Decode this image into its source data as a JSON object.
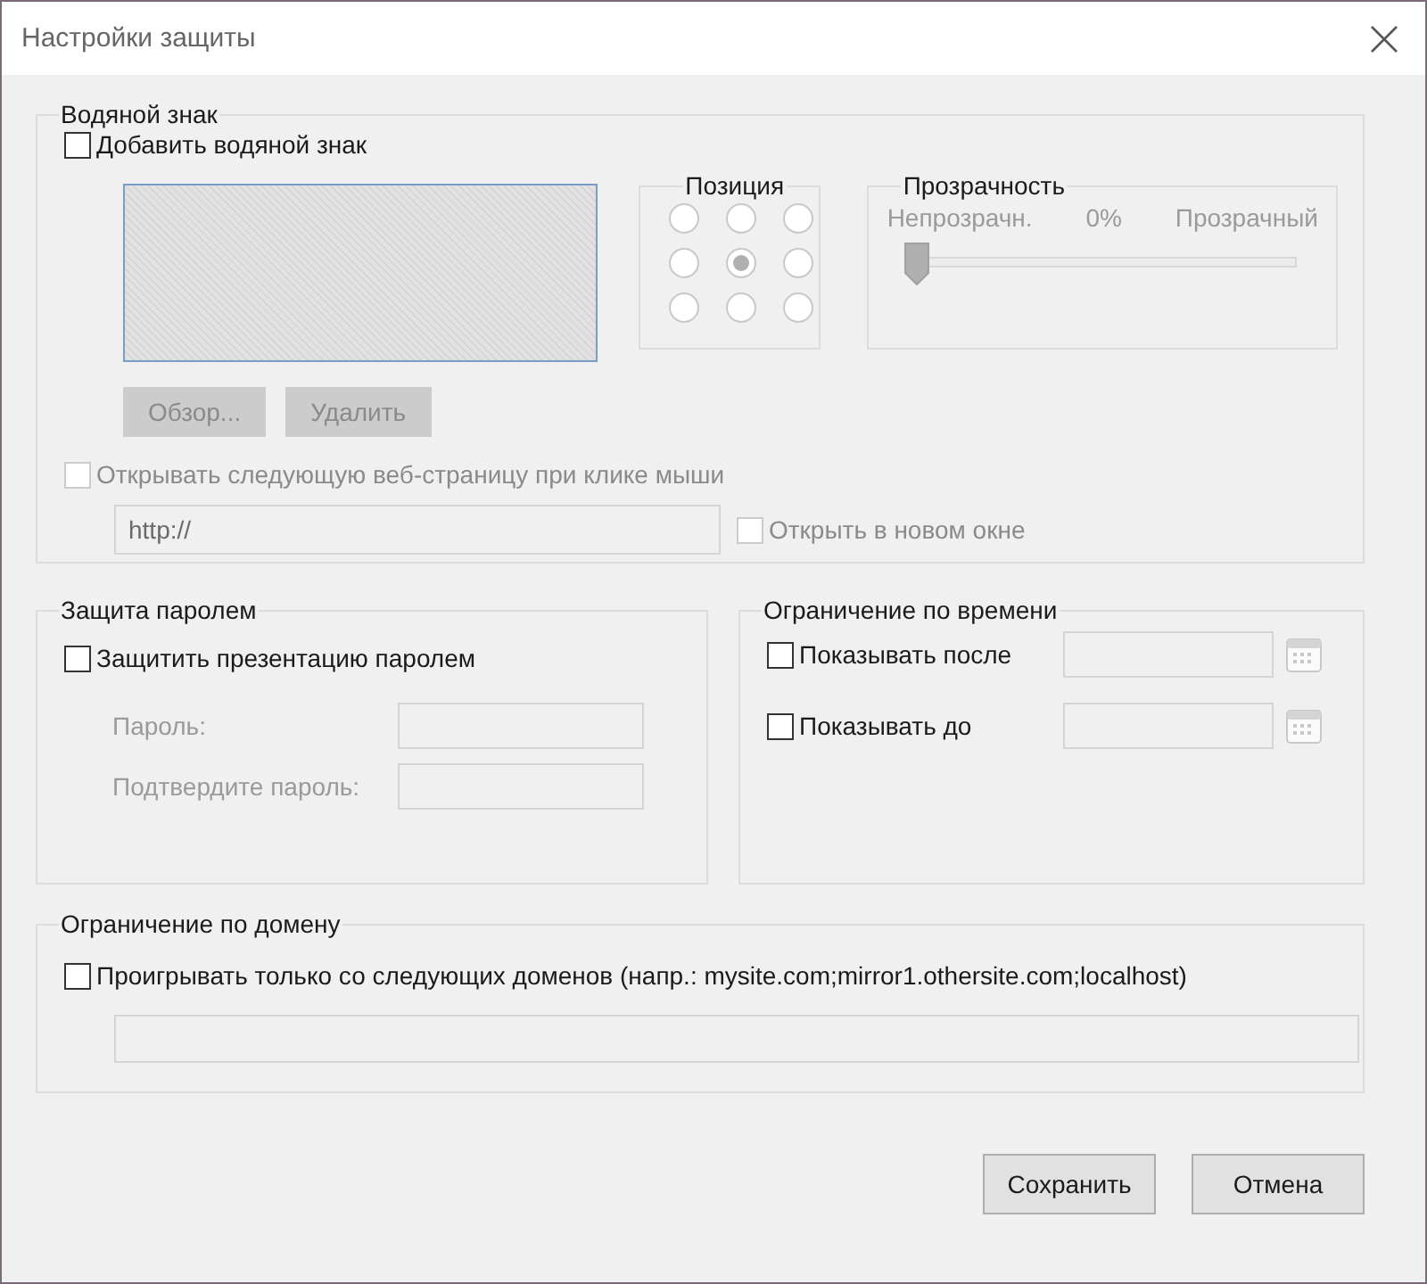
{
  "window": {
    "title": "Настройки защиты"
  },
  "watermark": {
    "legend": "Водяной знак",
    "add": {
      "label": "Добавить водяной знак",
      "checked": false,
      "disabled": false
    },
    "position": {
      "legend": "Позиция",
      "options": [
        {
          "selected": false
        },
        {
          "selected": false
        },
        {
          "selected": false
        },
        {
          "selected": false
        },
        {
          "selected": true
        },
        {
          "selected": false
        },
        {
          "selected": false
        },
        {
          "selected": false
        },
        {
          "selected": false
        }
      ],
      "disabled": true
    },
    "transparency": {
      "legend": "Прозрачность",
      "min_label": "Непрозрачн.",
      "value": "0%",
      "max_label": "Прозрачный",
      "level": 0,
      "disabled": true
    },
    "buttons": [
      {
        "label": "Обзор...",
        "disabled": true
      },
      {
        "label": "Удалить",
        "disabled": true
      }
    ],
    "open_link": {
      "label": "Открывать следующую веб-страницу при клике мыши",
      "checked": false,
      "disabled": true
    },
    "url": {
      "value": "http://",
      "disabled": true
    },
    "new_window": {
      "label": "Открыть в новом окне",
      "checked": false,
      "disabled": true
    }
  },
  "password": {
    "legend": "Защита паролем",
    "protect": {
      "label": "Защитить презентацию паролем",
      "checked": false,
      "disabled": false
    },
    "fields": [
      {
        "label": "Пароль:",
        "disabled": true
      },
      {
        "label": "Подтвердите пароль:",
        "disabled": true
      }
    ]
  },
  "time": {
    "legend": "Ограничение по времени",
    "rows": [
      {
        "label": "Показывать после",
        "checked": false,
        "disabled": false
      },
      {
        "label": "Показывать до",
        "checked": false,
        "disabled": false
      }
    ]
  },
  "domain": {
    "legend": "Ограничение по домену",
    "restrict": {
      "label": "Проигрывать только со следующих доменов (напр.: mysite.com;mirror1.othersite.com;localhost)",
      "checked": false,
      "disabled": false
    }
  },
  "buttons": [
    {
      "label": "Сохранить"
    },
    {
      "label": "Отмена"
    }
  ]
}
